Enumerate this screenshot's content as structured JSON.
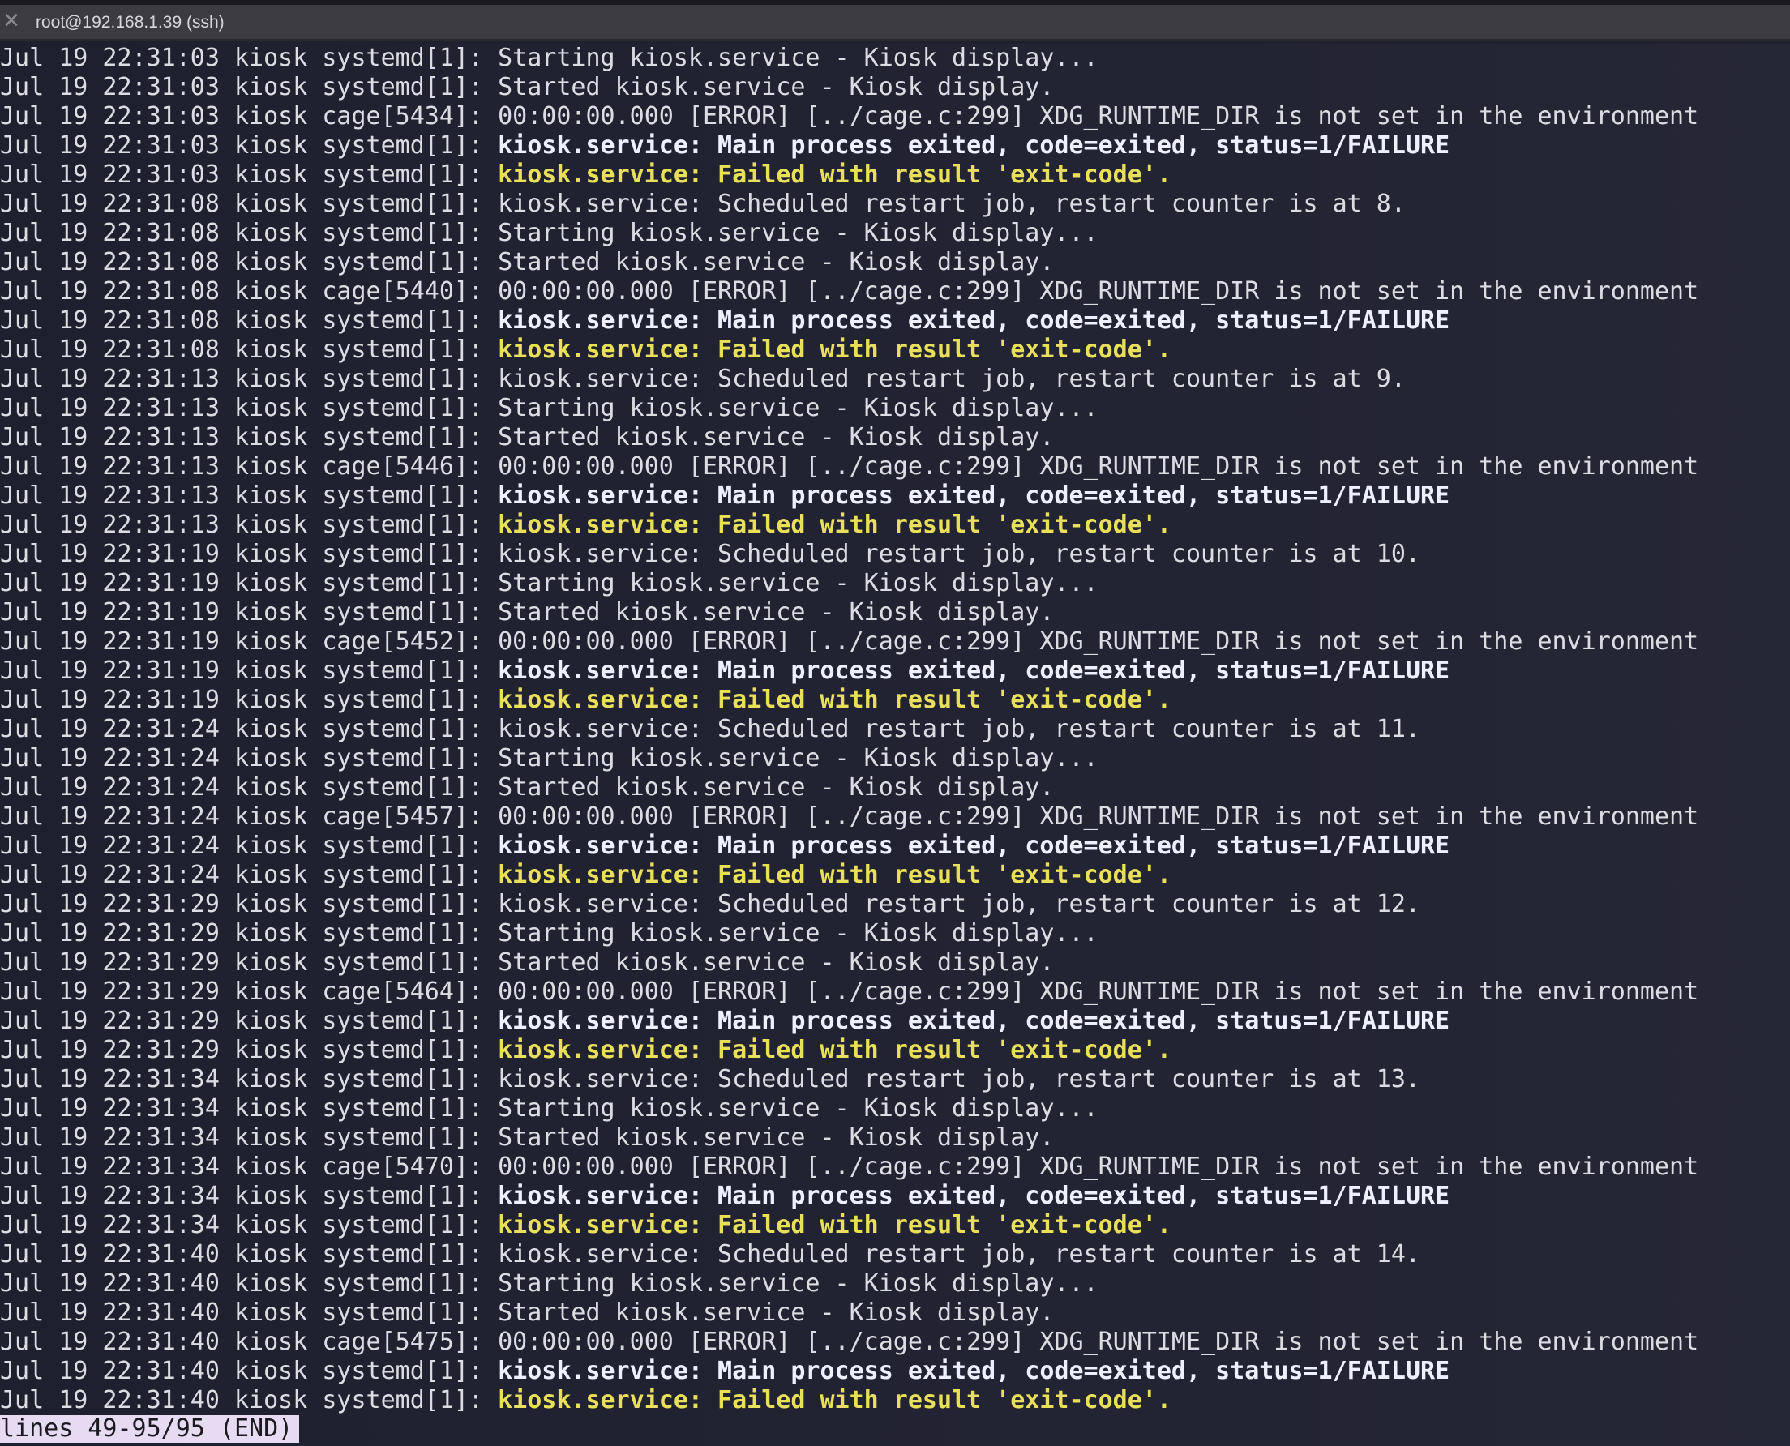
{
  "window": {
    "title": "root@192.168.1.39 (ssh)",
    "close_glyph": "✕"
  },
  "colors": {
    "background": "#1f2130",
    "text": "#dcdde2",
    "bold_text": "#eef0ff",
    "yellow_text": "#e9e05a",
    "status_bg": "#e6dbf3"
  },
  "icons": [
    "close-icon"
  ],
  "log_lines": [
    {
      "prefix": "Jul 19 22:31:03 kiosk systemd[1]: ",
      "message": "Starting kiosk.service - Kiosk display...",
      "style": "normal"
    },
    {
      "prefix": "Jul 19 22:31:03 kiosk systemd[1]: ",
      "message": "Started kiosk.service - Kiosk display.",
      "style": "normal"
    },
    {
      "prefix": "Jul 19 22:31:03 kiosk cage[5434]: ",
      "message": "00:00:00.000 [ERROR] [../cage.c:299] XDG_RUNTIME_DIR is not set in the environment",
      "style": "normal"
    },
    {
      "prefix": "Jul 19 22:31:03 kiosk systemd[1]: ",
      "message": "kiosk.service: Main process exited, code=exited, status=1/FAILURE",
      "style": "bold"
    },
    {
      "prefix": "Jul 19 22:31:03 kiosk systemd[1]: ",
      "message": "kiosk.service: Failed with result 'exit-code'.",
      "style": "yellow"
    },
    {
      "prefix": "Jul 19 22:31:08 kiosk systemd[1]: ",
      "message": "kiosk.service: Scheduled restart job, restart counter is at 8.",
      "style": "normal"
    },
    {
      "prefix": "Jul 19 22:31:08 kiosk systemd[1]: ",
      "message": "Starting kiosk.service - Kiosk display...",
      "style": "normal"
    },
    {
      "prefix": "Jul 19 22:31:08 kiosk systemd[1]: ",
      "message": "Started kiosk.service - Kiosk display.",
      "style": "normal"
    },
    {
      "prefix": "Jul 19 22:31:08 kiosk cage[5440]: ",
      "message": "00:00:00.000 [ERROR] [../cage.c:299] XDG_RUNTIME_DIR is not set in the environment",
      "style": "normal"
    },
    {
      "prefix": "Jul 19 22:31:08 kiosk systemd[1]: ",
      "message": "kiosk.service: Main process exited, code=exited, status=1/FAILURE",
      "style": "bold"
    },
    {
      "prefix": "Jul 19 22:31:08 kiosk systemd[1]: ",
      "message": "kiosk.service: Failed with result 'exit-code'.",
      "style": "yellow"
    },
    {
      "prefix": "Jul 19 22:31:13 kiosk systemd[1]: ",
      "message": "kiosk.service: Scheduled restart job, restart counter is at 9.",
      "style": "normal"
    },
    {
      "prefix": "Jul 19 22:31:13 kiosk systemd[1]: ",
      "message": "Starting kiosk.service - Kiosk display...",
      "style": "normal"
    },
    {
      "prefix": "Jul 19 22:31:13 kiosk systemd[1]: ",
      "message": "Started kiosk.service - Kiosk display.",
      "style": "normal"
    },
    {
      "prefix": "Jul 19 22:31:13 kiosk cage[5446]: ",
      "message": "00:00:00.000 [ERROR] [../cage.c:299] XDG_RUNTIME_DIR is not set in the environment",
      "style": "normal"
    },
    {
      "prefix": "Jul 19 22:31:13 kiosk systemd[1]: ",
      "message": "kiosk.service: Main process exited, code=exited, status=1/FAILURE",
      "style": "bold"
    },
    {
      "prefix": "Jul 19 22:31:13 kiosk systemd[1]: ",
      "message": "kiosk.service: Failed with result 'exit-code'.",
      "style": "yellow"
    },
    {
      "prefix": "Jul 19 22:31:19 kiosk systemd[1]: ",
      "message": "kiosk.service: Scheduled restart job, restart counter is at 10.",
      "style": "normal"
    },
    {
      "prefix": "Jul 19 22:31:19 kiosk systemd[1]: ",
      "message": "Starting kiosk.service - Kiosk display...",
      "style": "normal"
    },
    {
      "prefix": "Jul 19 22:31:19 kiosk systemd[1]: ",
      "message": "Started kiosk.service - Kiosk display.",
      "style": "normal"
    },
    {
      "prefix": "Jul 19 22:31:19 kiosk cage[5452]: ",
      "message": "00:00:00.000 [ERROR] [../cage.c:299] XDG_RUNTIME_DIR is not set in the environment",
      "style": "normal"
    },
    {
      "prefix": "Jul 19 22:31:19 kiosk systemd[1]: ",
      "message": "kiosk.service: Main process exited, code=exited, status=1/FAILURE",
      "style": "bold"
    },
    {
      "prefix": "Jul 19 22:31:19 kiosk systemd[1]: ",
      "message": "kiosk.service: Failed with result 'exit-code'.",
      "style": "yellow"
    },
    {
      "prefix": "Jul 19 22:31:24 kiosk systemd[1]: ",
      "message": "kiosk.service: Scheduled restart job, restart counter is at 11.",
      "style": "normal"
    },
    {
      "prefix": "Jul 19 22:31:24 kiosk systemd[1]: ",
      "message": "Starting kiosk.service - Kiosk display...",
      "style": "normal"
    },
    {
      "prefix": "Jul 19 22:31:24 kiosk systemd[1]: ",
      "message": "Started kiosk.service - Kiosk display.",
      "style": "normal"
    },
    {
      "prefix": "Jul 19 22:31:24 kiosk cage[5457]: ",
      "message": "00:00:00.000 [ERROR] [../cage.c:299] XDG_RUNTIME_DIR is not set in the environment",
      "style": "normal"
    },
    {
      "prefix": "Jul 19 22:31:24 kiosk systemd[1]: ",
      "message": "kiosk.service: Main process exited, code=exited, status=1/FAILURE",
      "style": "bold"
    },
    {
      "prefix": "Jul 19 22:31:24 kiosk systemd[1]: ",
      "message": "kiosk.service: Failed with result 'exit-code'.",
      "style": "yellow"
    },
    {
      "prefix": "Jul 19 22:31:29 kiosk systemd[1]: ",
      "message": "kiosk.service: Scheduled restart job, restart counter is at 12.",
      "style": "normal"
    },
    {
      "prefix": "Jul 19 22:31:29 kiosk systemd[1]: ",
      "message": "Starting kiosk.service - Kiosk display...",
      "style": "normal"
    },
    {
      "prefix": "Jul 19 22:31:29 kiosk systemd[1]: ",
      "message": "Started kiosk.service - Kiosk display.",
      "style": "normal"
    },
    {
      "prefix": "Jul 19 22:31:29 kiosk cage[5464]: ",
      "message": "00:00:00.000 [ERROR] [../cage.c:299] XDG_RUNTIME_DIR is not set in the environment",
      "style": "normal"
    },
    {
      "prefix": "Jul 19 22:31:29 kiosk systemd[1]: ",
      "message": "kiosk.service: Main process exited, code=exited, status=1/FAILURE",
      "style": "bold"
    },
    {
      "prefix": "Jul 19 22:31:29 kiosk systemd[1]: ",
      "message": "kiosk.service: Failed with result 'exit-code'.",
      "style": "yellow"
    },
    {
      "prefix": "Jul 19 22:31:34 kiosk systemd[1]: ",
      "message": "kiosk.service: Scheduled restart job, restart counter is at 13.",
      "style": "normal"
    },
    {
      "prefix": "Jul 19 22:31:34 kiosk systemd[1]: ",
      "message": "Starting kiosk.service - Kiosk display...",
      "style": "normal"
    },
    {
      "prefix": "Jul 19 22:31:34 kiosk systemd[1]: ",
      "message": "Started kiosk.service - Kiosk display.",
      "style": "normal"
    },
    {
      "prefix": "Jul 19 22:31:34 kiosk cage[5470]: ",
      "message": "00:00:00.000 [ERROR] [../cage.c:299] XDG_RUNTIME_DIR is not set in the environment",
      "style": "normal"
    },
    {
      "prefix": "Jul 19 22:31:34 kiosk systemd[1]: ",
      "message": "kiosk.service: Main process exited, code=exited, status=1/FAILURE",
      "style": "bold"
    },
    {
      "prefix": "Jul 19 22:31:34 kiosk systemd[1]: ",
      "message": "kiosk.service: Failed with result 'exit-code'.",
      "style": "yellow"
    },
    {
      "prefix": "Jul 19 22:31:40 kiosk systemd[1]: ",
      "message": "kiosk.service: Scheduled restart job, restart counter is at 14.",
      "style": "normal"
    },
    {
      "prefix": "Jul 19 22:31:40 kiosk systemd[1]: ",
      "message": "Starting kiosk.service - Kiosk display...",
      "style": "normal"
    },
    {
      "prefix": "Jul 19 22:31:40 kiosk systemd[1]: ",
      "message": "Started kiosk.service - Kiosk display.",
      "style": "normal"
    },
    {
      "prefix": "Jul 19 22:31:40 kiosk cage[5475]: ",
      "message": "00:00:00.000 [ERROR] [../cage.c:299] XDG_RUNTIME_DIR is not set in the environment",
      "style": "normal"
    },
    {
      "prefix": "Jul 19 22:31:40 kiosk systemd[1]: ",
      "message": "kiosk.service: Main process exited, code=exited, status=1/FAILURE",
      "style": "bold"
    },
    {
      "prefix": "Jul 19 22:31:40 kiosk systemd[1]: ",
      "message": "kiosk.service: Failed with result 'exit-code'.",
      "style": "yellow"
    }
  ],
  "pager_status": "lines 49-95/95 (END)"
}
